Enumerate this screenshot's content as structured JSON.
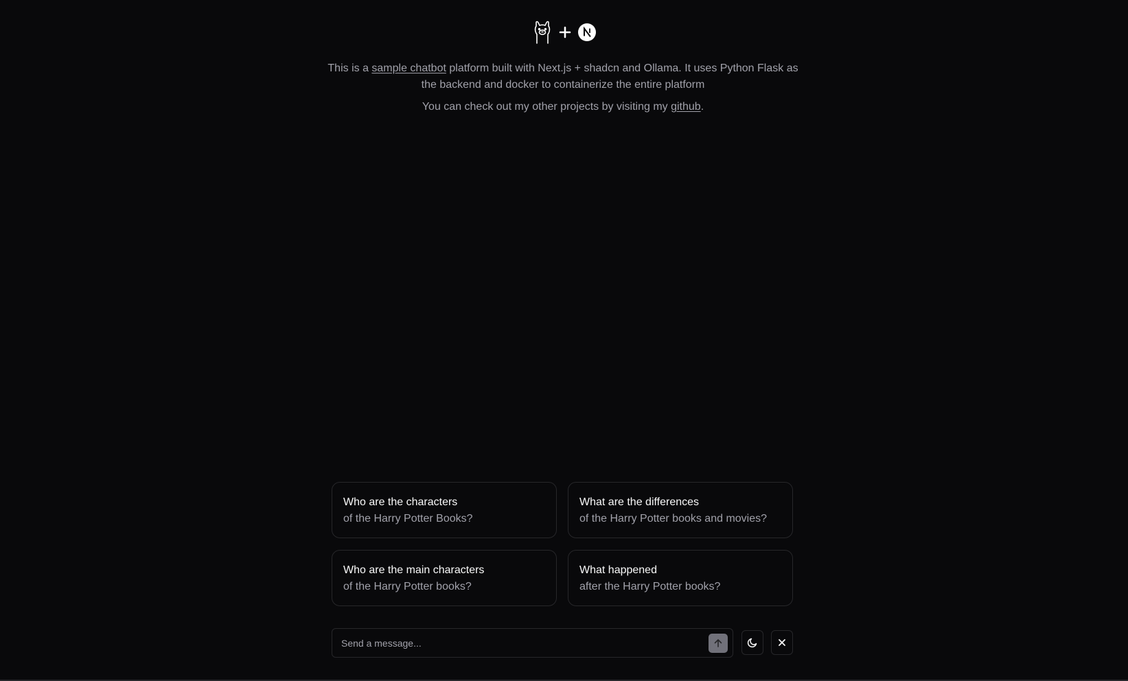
{
  "header": {
    "logos": [
      "ollama-logo",
      "plus-icon",
      "nextjs-logo"
    ]
  },
  "intro": {
    "line1_prefix": "This is a ",
    "line1_link": "sample chatbot",
    "line1_suffix": " platform built with Next.js + shadcn and Ollama. It uses Python Flask as the backend and docker to containerize the entire platform",
    "line2_prefix": "You can check out my other projects by visiting my ",
    "line2_link": "github",
    "line2_suffix": "."
  },
  "suggestions": [
    {
      "title": "Who are the characters",
      "subtitle": "of the Harry Potter Books?"
    },
    {
      "title": "What are the differences",
      "subtitle": "of the Harry Potter books and movies?"
    },
    {
      "title": "Who are the main characters",
      "subtitle": "of the Harry Potter books?"
    },
    {
      "title": "What happened",
      "subtitle": "after the Harry Potter books?"
    }
  ],
  "composer": {
    "placeholder": "Send a message...",
    "value": "",
    "send_icon": "arrow-up-icon"
  },
  "actions": {
    "theme_icon": "moon-icon",
    "close_icon": "close-icon"
  },
  "colors": {
    "background": "#09090b",
    "border": "#27272a",
    "text": "#fafafa",
    "muted_text": "#a1a1aa",
    "send_button": "#71717a"
  }
}
